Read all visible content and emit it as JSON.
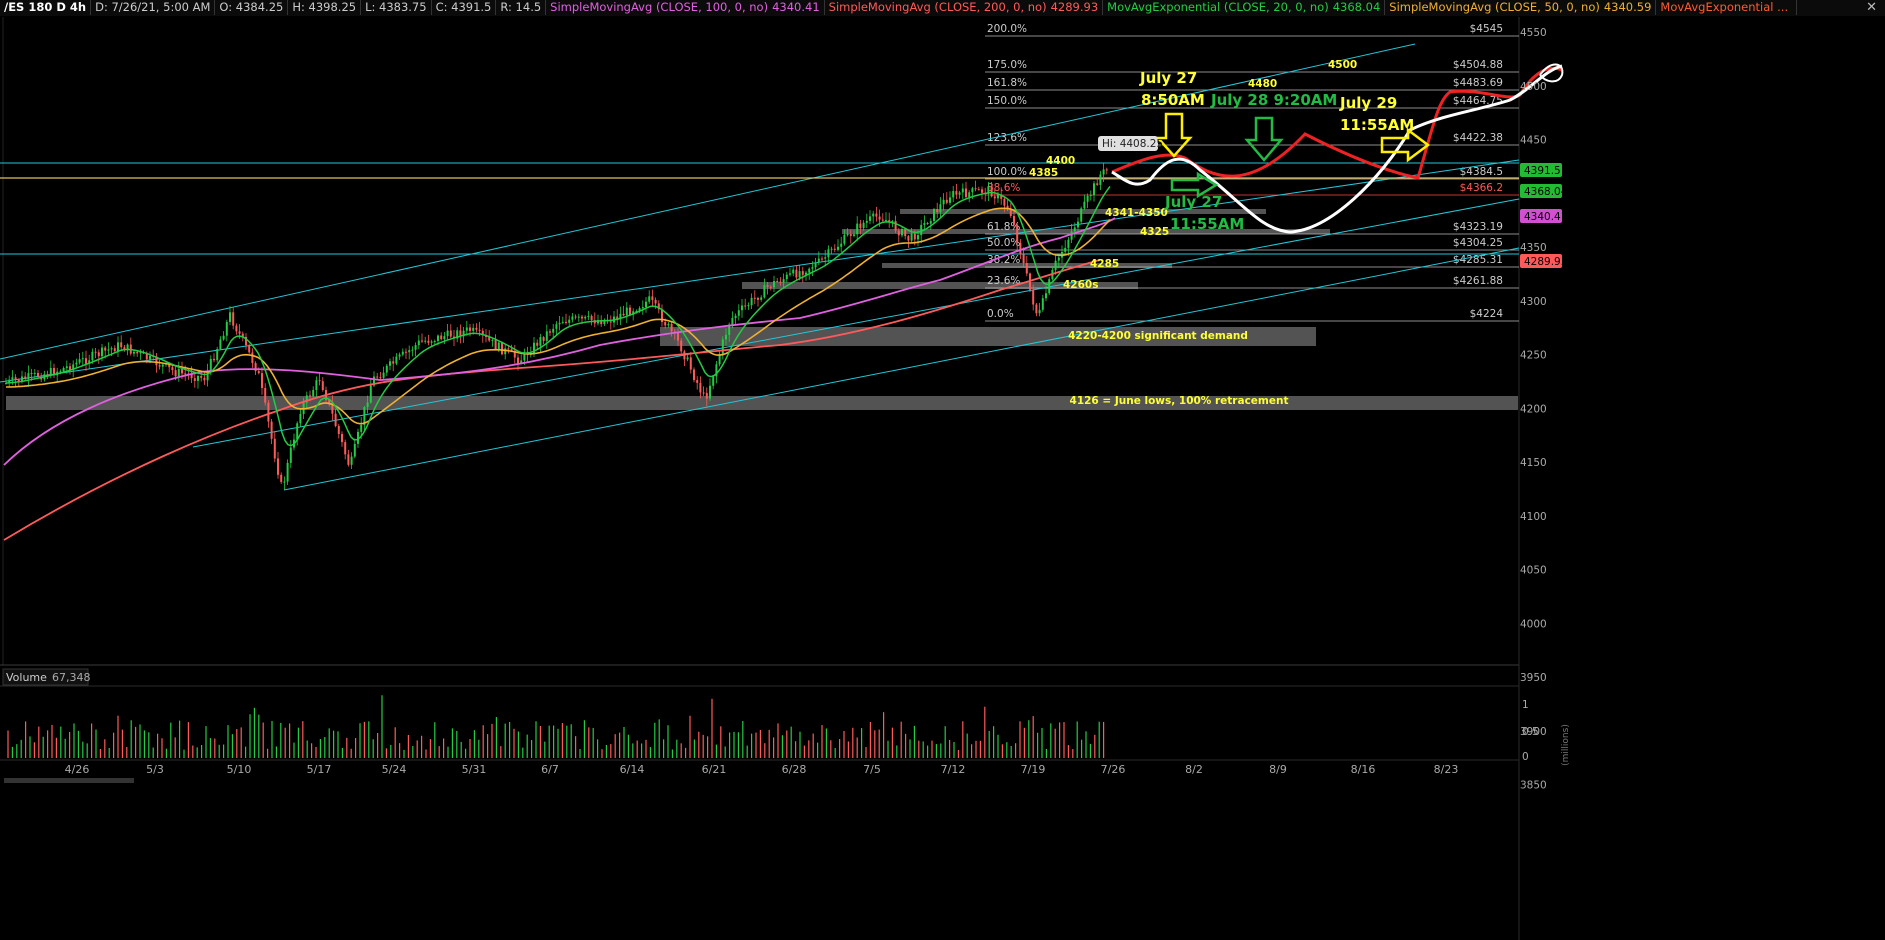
{
  "header": {
    "symbol": "/ES 180 D 4h",
    "date": "D: 7/26/21, 5:00 AM",
    "open": "O: 4384.25",
    "high": "H: 4398.25",
    "low": "L: 4383.75",
    "close": "C: 4391.5",
    "range": "R: 14.5",
    "indicators": [
      {
        "label": "SimpleMovingAvg (CLOSE, 100, 0, no)",
        "value": "4340.41",
        "color": "#e060e0"
      },
      {
        "label": "SimpleMovingAvg (CLOSE, 200, 0, no)",
        "value": "4289.93",
        "color": "#ff5a5a"
      },
      {
        "label": "MovAvgExponential (CLOSE, 20, 0, no)",
        "value": "4368.04",
        "color": "#22cc44"
      },
      {
        "label": "SimpleMovingAvg (CLOSE, 50, 0, no)",
        "value": "4340.59",
        "color": "#f0b030"
      },
      {
        "label": "MovAvgExponential ...",
        "value": "",
        "color": "#ff5a30"
      }
    ]
  },
  "price_axis": [
    "4550",
    "4500",
    "4450",
    "4400",
    "4350",
    "4300",
    "4250",
    "4200",
    "4150",
    "4100",
    "4050",
    "4000",
    "3950",
    "3900",
    "3850"
  ],
  "price_tags": [
    {
      "text": "4391.5",
      "bg": "#22bb33",
      "fg": "#000"
    },
    {
      "text": "4368.04",
      "bg": "#22bb33",
      "fg": "#000"
    },
    {
      "text": "4340.41",
      "bg": "#d050d0",
      "fg": "#000"
    },
    {
      "text": "4289.93",
      "bg": "#ff5a5a",
      "fg": "#000"
    }
  ],
  "fib_levels": [
    {
      "pct": "200.0%",
      "price": "$4545"
    },
    {
      "pct": "175.0%",
      "price": "$4504.88"
    },
    {
      "pct": "161.8%",
      "price": "$4483.69"
    },
    {
      "pct": "150.0%",
      "price": "$4464.75"
    },
    {
      "pct": "123.6%",
      "price": "$4422.38"
    },
    {
      "pct": "100.0%",
      "price": "$4384.5"
    },
    {
      "pct": "88.6%",
      "price": "$4366.2"
    },
    {
      "pct": "61.8%",
      "price": "$4323.19"
    },
    {
      "pct": "50.0%",
      "price": "$4304.25"
    },
    {
      "pct": "38.2%",
      "price": "$4285.31"
    },
    {
      "pct": "23.6%",
      "price": "$4261.88"
    },
    {
      "pct": "0.0%",
      "price": "$4224"
    }
  ],
  "annotations": {
    "hi_label": "Hi: 4408.25",
    "l4400": "4400",
    "l4385": "4385",
    "l4341": "4341-4350",
    "l4325": "4325",
    "l4285": "4285",
    "l4260": "4260s",
    "l4480": "4480",
    "l4500": "4500",
    "demand": "4220-4200 significant demand",
    "june_lows": "4126 = June lows, 100% retracement",
    "july27_a1": "July 27",
    "july27_a2": "8:50AM",
    "july28": "July 28 9:20AM",
    "july29_1": "July 29",
    "july29_2": "11:55AM",
    "july27_b1": "July 27",
    "july27_b2": "11:55AM"
  },
  "dates": [
    "4/26",
    "5/3",
    "5/10",
    "5/17",
    "5/24",
    "5/31",
    "6/7",
    "6/14",
    "6/21",
    "6/28",
    "7/5",
    "7/12",
    "7/19",
    "7/26",
    "8/2",
    "8/9",
    "8/16",
    "8/23"
  ],
  "volume": {
    "label": "Volume",
    "value": "67,348",
    "axis": [
      "1",
      "0.5",
      "0"
    ],
    "unit": "(millions)"
  },
  "colors": {
    "up": "#22cc44",
    "down": "#ff5a5a",
    "channel": "#22c8d8",
    "fib": "#ffffff",
    "sma100": "#e060e0",
    "sma200": "#ff5a5a",
    "ema20": "#22cc44",
    "sma50": "#f0b030",
    "annotation_yellow": "#ffff33",
    "annotation_green": "#22bb44",
    "zone": "#808080"
  }
}
